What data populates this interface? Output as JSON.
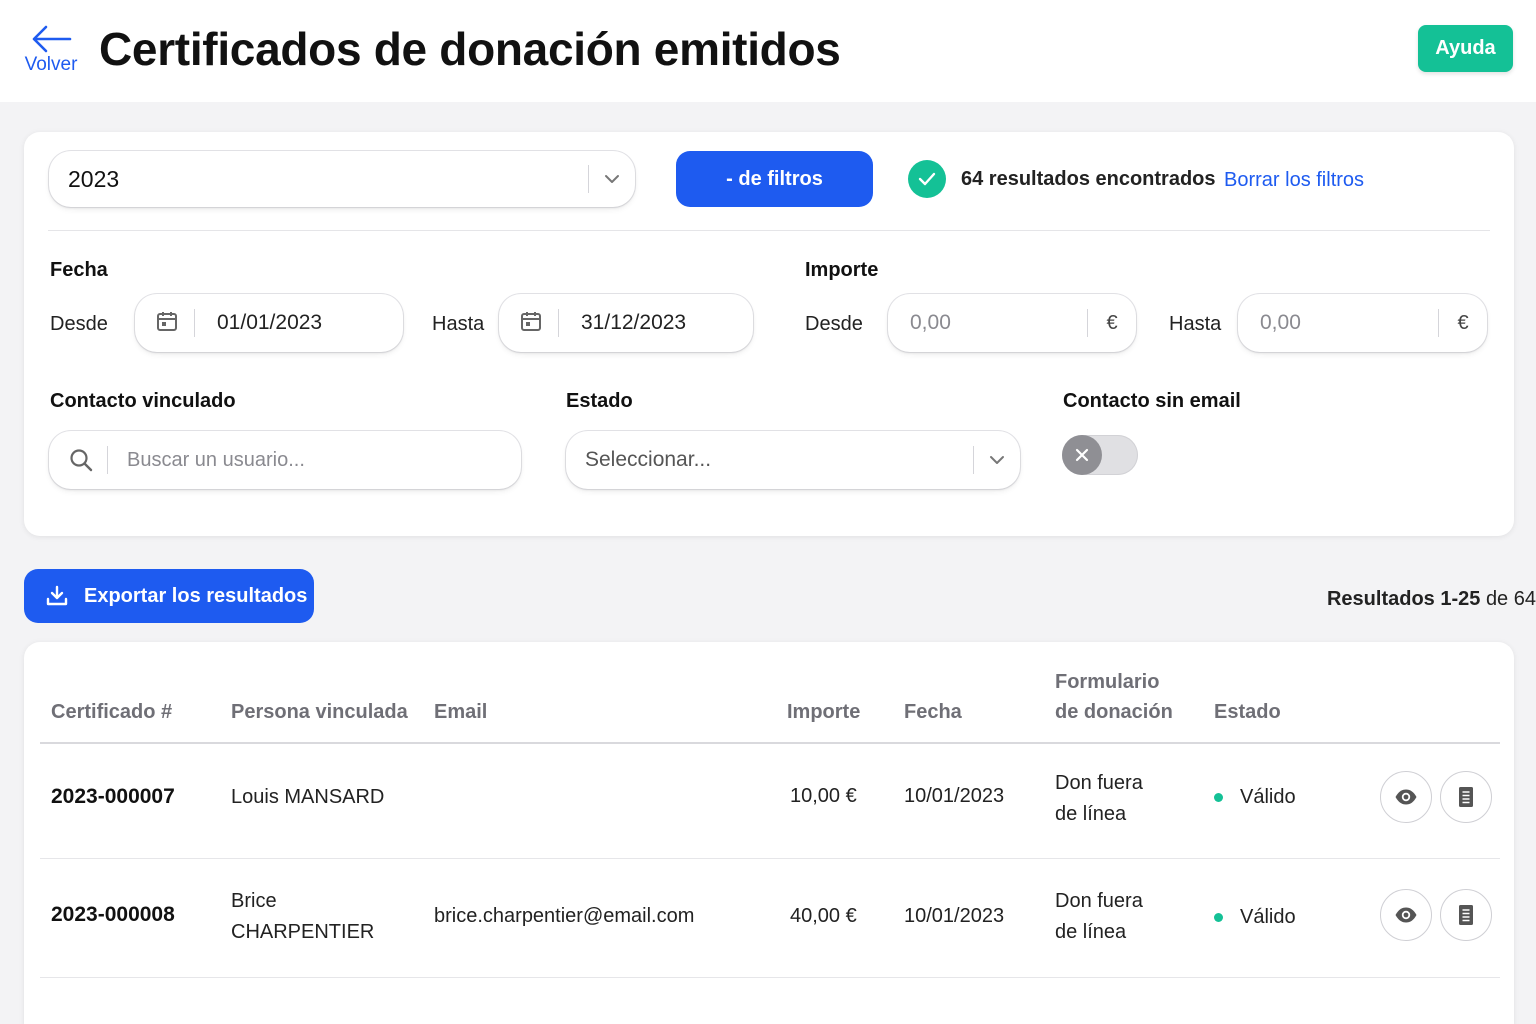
{
  "header": {
    "back_label": "Volver",
    "title": "Certificados de donación emitidos",
    "help_label": "Ayuda"
  },
  "filters": {
    "year": "2023",
    "toggle_filters_label": "- de filtros",
    "results_found": "64 resultados encontrados",
    "clear_filters_label": "Borrar los filtros",
    "date": {
      "label": "Fecha",
      "from_label": "Desde",
      "from_value": "01/01/2023",
      "to_label": "Hasta",
      "to_value": "31/12/2023"
    },
    "amount": {
      "label": "Importe",
      "from_label": "Desde",
      "from_placeholder": "0,00",
      "to_label": "Hasta",
      "to_placeholder": "0,00",
      "currency": "€"
    },
    "linked_contact": {
      "label": "Contacto vinculado",
      "placeholder": "Buscar un usuario..."
    },
    "state": {
      "label": "Estado",
      "placeholder": "Seleccionar..."
    },
    "no_email": {
      "label": "Contacto sin email",
      "enabled": false
    }
  },
  "toolbar": {
    "export_label": "Exportar los resultados",
    "range_prefix": "Resultados 1-25",
    "range_suffix": "de 64"
  },
  "table": {
    "columns": {
      "certificate": "Certificado #",
      "person": "Persona vinculada",
      "email": "Email",
      "amount": "Importe",
      "date": "Fecha",
      "form_line1": "Formulario",
      "form_line2": "de donación",
      "status": "Estado"
    },
    "rows": [
      {
        "certificate": "2023-000007",
        "person_line1": "Louis MANSARD",
        "person_line2": "",
        "email": "",
        "amount": "10,00 €",
        "date": "10/01/2023",
        "form_line1": "Don fuera",
        "form_line2": "de línea",
        "status": "Válido"
      },
      {
        "certificate": "2023-000008",
        "person_line1": "Brice",
        "person_line2": "CHARPENTIER",
        "email": "brice.charpentier@email.com",
        "amount": "40,00 €",
        "date": "10/01/2023",
        "form_line1": "Don fuera",
        "form_line2": "de línea",
        "status": "Válido"
      }
    ]
  },
  "colors": {
    "primary": "#1e5bf0",
    "success": "#14c196"
  }
}
